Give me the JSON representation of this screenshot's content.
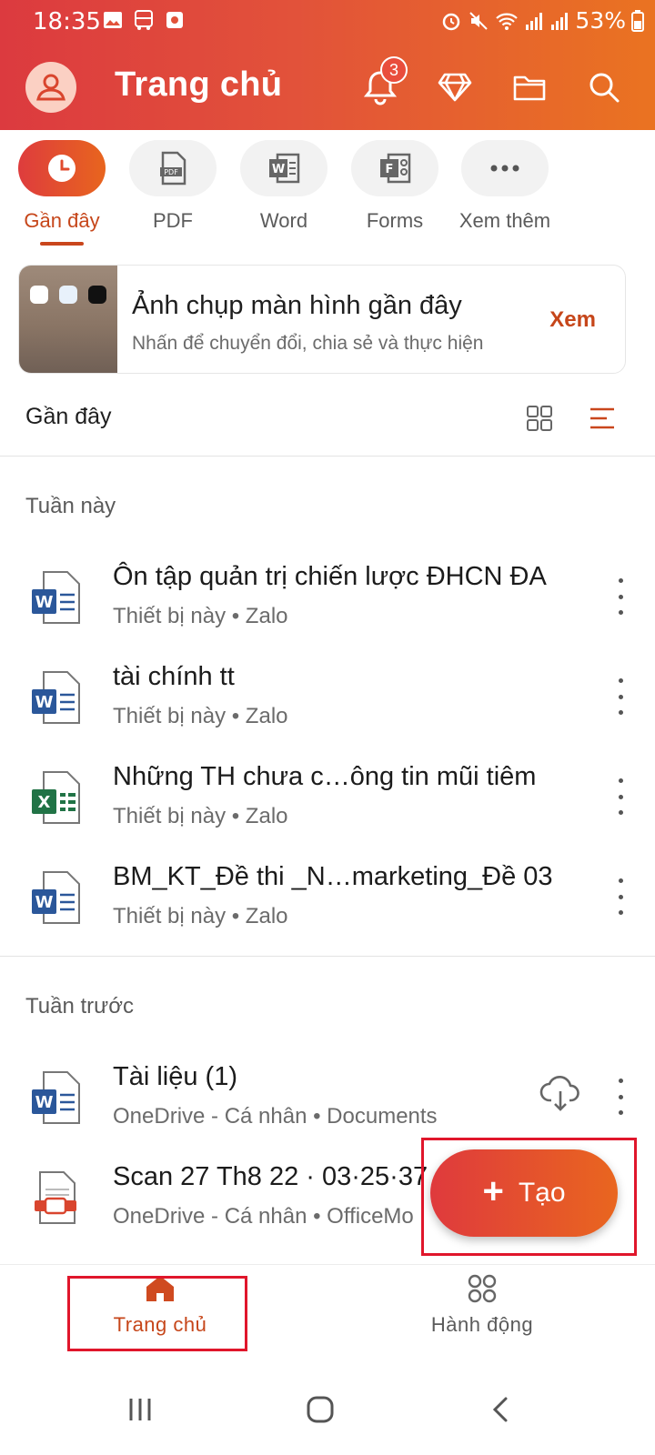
{
  "status": {
    "time": "18:35",
    "battery": "53%"
  },
  "header": {
    "title": "Trang chủ",
    "notification_count": "3"
  },
  "categories": [
    {
      "label": "Gần đây",
      "active": true
    },
    {
      "label": "PDF"
    },
    {
      "label": "Word"
    },
    {
      "label": "Forms"
    },
    {
      "label": "Xem thêm"
    }
  ],
  "screenshot_card": {
    "title": "Ảnh chụp màn hình gần đây",
    "subtitle": "Nhấn để chuyển đổi, chia sẻ và thực hiện",
    "action": "Xem"
  },
  "recent": {
    "title": "Gần đây"
  },
  "sections": [
    {
      "title": "Tuần này",
      "files": [
        {
          "name": "Ôn tập quản trị chiến lược ĐHCN ĐA",
          "meta": "Thiết bị này • Zalo",
          "type": "word"
        },
        {
          "name": "tài chính tt",
          "meta": "Thiết bị này • Zalo",
          "type": "word"
        },
        {
          "name": "Những TH chưa c…ông tin mũi tiêm",
          "meta": "Thiết bị này • Zalo",
          "type": "excel"
        },
        {
          "name": "BM_KT_Đề thi _N…marketing_Đề 03",
          "meta": "Thiết bị này • Zalo",
          "type": "word"
        }
      ]
    },
    {
      "title": "Tuần trước",
      "files": [
        {
          "name": "Tài liệu (1)",
          "meta": "OneDrive - Cá nhân • Documents",
          "type": "word"
        },
        {
          "name": "Scan 27 Th8 22 · 03·25·37",
          "meta": "OneDrive - Cá nhân • OfficeMo",
          "type": "scan"
        }
      ]
    }
  ],
  "fab": {
    "label": "Tạo"
  },
  "bottom_nav": [
    {
      "label": "Trang chủ",
      "active": true
    },
    {
      "label": "Hành động"
    }
  ],
  "colors": {
    "accent": "#c6461a",
    "gradient_start": "#dc3a3f",
    "gradient_end": "#ea7321",
    "highlight_outline": "#e0162b"
  }
}
